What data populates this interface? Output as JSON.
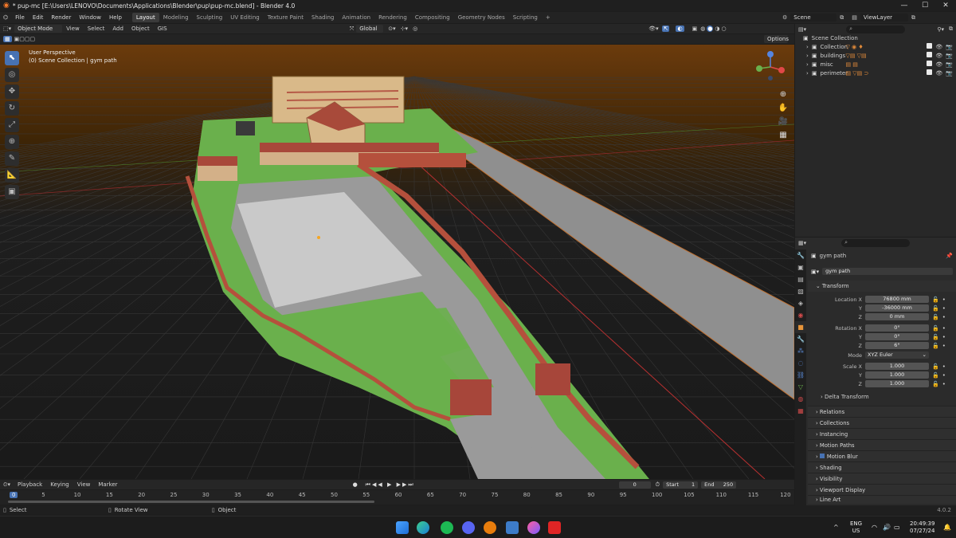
{
  "window": {
    "title": "* pup-mc [E:\\Users\\LENOVO\\Documents\\Applications\\Blender\\pup\\pup-mc.blend] - Blender 4.0",
    "minimize": "—",
    "maximize": "☐",
    "close": "✕"
  },
  "menubar": {
    "menus": [
      "File",
      "Edit",
      "Render",
      "Window",
      "Help"
    ],
    "workspaces": [
      "Layout",
      "Modeling",
      "Sculpting",
      "UV Editing",
      "Texture Paint",
      "Shading",
      "Animation",
      "Rendering",
      "Compositing",
      "Geometry Nodes",
      "Scripting"
    ],
    "add_workspace": "+",
    "scene": "Scene",
    "view_layer": "ViewLayer"
  },
  "viewport_header": {
    "mode": "Object Mode",
    "menus": [
      "View",
      "Select",
      "Add",
      "Object",
      "GIS"
    ],
    "orientation": "Global",
    "options": "Options"
  },
  "viewport": {
    "perspective": "User Perspective",
    "collection": "(0) Scene Collection | gym path",
    "gizmo_axes": [
      "X",
      "Y",
      "Z"
    ]
  },
  "outliner": {
    "root": "Scene Collection",
    "items": [
      {
        "name": "Collection"
      },
      {
        "name": "buildings"
      },
      {
        "name": "misc"
      },
      {
        "name": "perimeter"
      }
    ]
  },
  "properties": {
    "object_name": "gym path",
    "datablock_name": "gym path",
    "transform_label": "Transform",
    "location_label": "Location X",
    "location": [
      {
        "axis": "Location X",
        "value": "76800 mm"
      },
      {
        "axis": "Y",
        "value": "-36000 mm"
      },
      {
        "axis": "Z",
        "value": "0 mm"
      }
    ],
    "rotation": [
      {
        "axis": "Rotation X",
        "value": "0°"
      },
      {
        "axis": "Y",
        "value": "0°"
      },
      {
        "axis": "Z",
        "value": "6°"
      }
    ],
    "mode_label": "Mode",
    "mode_value": "XYZ Euler",
    "scale": [
      {
        "axis": "Scale X",
        "value": "1.000"
      },
      {
        "axis": "Y",
        "value": "1.000"
      },
      {
        "axis": "Z",
        "value": "1.000"
      }
    ],
    "delta_transform": "Delta Transform",
    "sections": [
      "Relations",
      "Collections",
      "Instancing",
      "Motion Paths",
      "Motion Blur",
      "Shading",
      "Visibility",
      "Viewport Display",
      "Line Art"
    ]
  },
  "timeline": {
    "menus": [
      "Playback",
      "Keying",
      "View",
      "Marker"
    ],
    "current_frame": "0",
    "start_label": "Start",
    "start": "1",
    "end_label": "End",
    "end": "250",
    "ticks": [
      "0",
      "5",
      "10",
      "15",
      "20",
      "25",
      "30",
      "35",
      "40",
      "45",
      "50",
      "55",
      "60",
      "65",
      "70",
      "75",
      "80",
      "85",
      "90",
      "95",
      "100",
      "105",
      "110",
      "115",
      "120"
    ]
  },
  "statusbar": {
    "select": "Select",
    "rotate": "Rotate View",
    "object": "Object",
    "version": "4.0.2"
  },
  "taskbar": {
    "lang": "ENG",
    "region": "US",
    "time": "20:49:39",
    "date": "07/27/24"
  },
  "colors": {
    "accent": "#4772b3",
    "grass": "#6ab04c",
    "wall": "#b5503c",
    "road": "#9a9a9a"
  }
}
